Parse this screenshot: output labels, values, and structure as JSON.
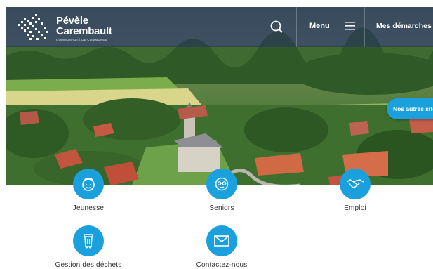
{
  "header": {
    "logo_title_line1": "Pévèle",
    "logo_title_line2": "Carembault",
    "logo_subtitle": "COMMUNAUTÉ DE COMMUNES",
    "menu_label": "Menu",
    "demarches_label": "Mes démarches"
  },
  "hero": {
    "autres_sites_label": "Nos autres sites"
  },
  "quick_links": [
    {
      "label": "Jeunesse",
      "icon": "child-face-icon"
    },
    {
      "label": "Seniors",
      "icon": "senior-face-icon"
    },
    {
      "label": "Emploi",
      "icon": "handshake-icon"
    },
    {
      "label": "Gestion des déchets",
      "icon": "bin-icon"
    },
    {
      "label": "Contactez-nous",
      "icon": "envelope-icon"
    }
  ],
  "colors": {
    "accent": "#1aa0dc",
    "header_bg": "#2c3e52",
    "text": "#333333"
  }
}
